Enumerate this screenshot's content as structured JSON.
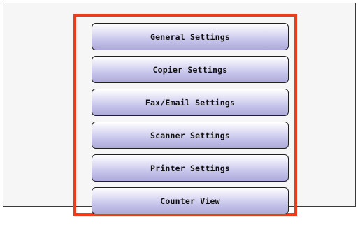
{
  "menu": {
    "items": [
      {
        "label": "General Settings"
      },
      {
        "label": "Copier Settings"
      },
      {
        "label": "Fax/Email Settings"
      },
      {
        "label": "Scanner Settings"
      },
      {
        "label": "Printer Settings"
      },
      {
        "label": "Counter View"
      }
    ],
    "highlight_color": "#ee3b1c",
    "button_color": "#c5c3ea"
  }
}
